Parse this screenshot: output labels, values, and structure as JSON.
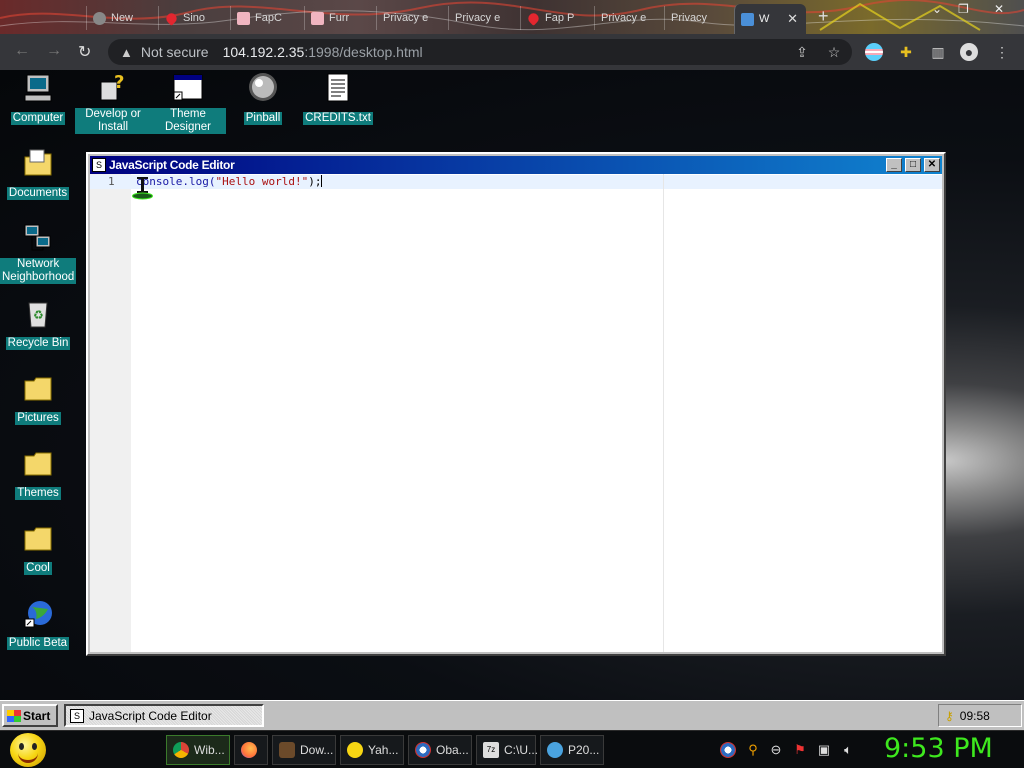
{
  "browser": {
    "tabs": [
      {
        "label": "New",
        "color": "#888888"
      },
      {
        "label": "Sino",
        "color": "#e3262f"
      },
      {
        "label": "FapC",
        "color": "#f0b5c0"
      },
      {
        "label": "Furr",
        "color": "#f0b5c0"
      },
      {
        "label": "Privacy e",
        "color": "#777777"
      },
      {
        "label": "Privacy e",
        "color": "#777777"
      },
      {
        "label": "Fap P",
        "color": "#e3262f"
      },
      {
        "label": "Privacy e",
        "color": "#777777"
      },
      {
        "label": "Privacy",
        "color": "#777777"
      },
      {
        "label": "W",
        "color": "#4a8fd8",
        "active": true
      }
    ],
    "new_tab": "+",
    "address": {
      "security_label": "Not secure",
      "host": "104.192.2.35",
      "path": ":1998/desktop.html"
    }
  },
  "desktop": {
    "icons": [
      {
        "label": "Computer"
      },
      {
        "label": "Develop or Install"
      },
      {
        "label": "Theme Designer"
      },
      {
        "label": "Pinball"
      },
      {
        "label": "CREDITS.txt"
      },
      {
        "label": "Documents"
      },
      {
        "label": "Network Neighborhood"
      },
      {
        "label": "Recycle Bin"
      },
      {
        "label": "Pictures"
      },
      {
        "label": "Themes"
      },
      {
        "label": "Cool"
      },
      {
        "label": "Public Beta"
      }
    ],
    "label_color": "#0f7c7c"
  },
  "editor": {
    "title": "JavaScript Code Editor",
    "line_number": "1",
    "code": {
      "fn": "console.log(",
      "str": "\"Hello world!\"",
      "tail": ");"
    }
  },
  "taskbar": {
    "start_label": "Start",
    "task_label": "JavaScript Code Editor",
    "clock": "09:58"
  },
  "host_taskbar": {
    "items": [
      {
        "label": "Wib...",
        "color": "#db4437"
      },
      {
        "label": "",
        "color": "#ff7139"
      },
      {
        "label": "Dow...",
        "color": "#6b4a2a"
      },
      {
        "label": "Yah...",
        "color": "#f7d613"
      },
      {
        "label": "Oba...",
        "color": "#2d6cc0"
      },
      {
        "label": "C:\\U...",
        "color": "#dddddd"
      },
      {
        "label": "P20...",
        "color": "#4aa3df"
      }
    ],
    "clock": "9:53 PM",
    "clock_color": "#3ee81e"
  }
}
